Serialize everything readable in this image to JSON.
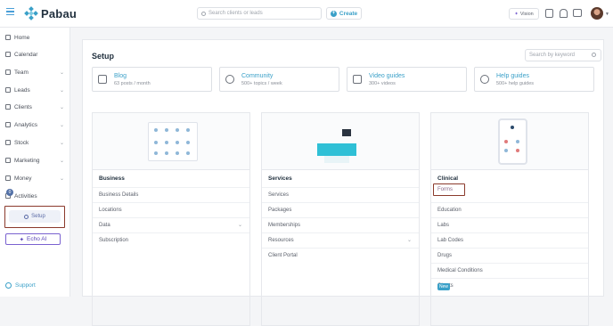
{
  "app": {
    "name": "Pabau"
  },
  "header": {
    "search_placeholder": "Search clients or leads",
    "create_label": "Create",
    "vision_label": "Vision"
  },
  "sidebar": {
    "items": [
      {
        "label": "Home",
        "icon": "home-icon"
      },
      {
        "label": "Calendar",
        "icon": "calendar-icon"
      },
      {
        "label": "Team",
        "icon": "team-icon",
        "chevron": true
      },
      {
        "label": "Leads",
        "icon": "leads-icon",
        "chevron": true
      },
      {
        "label": "Clients",
        "icon": "clients-icon",
        "chevron": true
      },
      {
        "label": "Analytics",
        "icon": "analytics-icon",
        "chevron": true
      },
      {
        "label": "Stock",
        "icon": "stock-icon",
        "chevron": true
      },
      {
        "label": "Marketing",
        "icon": "marketing-icon",
        "chevron": true
      },
      {
        "label": "Money",
        "icon": "money-icon",
        "chevron": true
      },
      {
        "label": "Activities",
        "icon": "activities-icon"
      }
    ],
    "activities_badge": "0",
    "setup_label": "Setup",
    "echo_label": "Echo AI",
    "support_label": "Support"
  },
  "main": {
    "title": "Setup",
    "search_placeholder": "Search by keyword",
    "resources": [
      {
        "title": "Blog",
        "sub": "63 posts / month",
        "icon": "blog-icon"
      },
      {
        "title": "Community",
        "sub": "500+ topics / week",
        "icon": "community-icon"
      },
      {
        "title": "Video guides",
        "sub": "300+ videos",
        "icon": "video-icon"
      },
      {
        "title": "Help guides",
        "sub": "500+ help guides",
        "icon": "help-icon"
      }
    ],
    "categories": [
      {
        "title": "Business",
        "rows": [
          "Business Details",
          "Locations",
          "Data",
          "Subscription"
        ]
      },
      {
        "title": "Services",
        "rows": [
          "Services",
          "Packages",
          "Memberships",
          "Resources",
          "Client Portal"
        ]
      },
      {
        "title": "Clinical",
        "rows": [
          "Forms",
          "Education",
          "Labs",
          "Lab Codes",
          "Drugs",
          "Medical Conditions",
          "Charts"
        ]
      }
    ],
    "new_badge": "New"
  },
  "colors": {
    "accent": "#3aa0c8",
    "highlight_border": "#8b3a2c",
    "echo": "#7a62d0"
  }
}
